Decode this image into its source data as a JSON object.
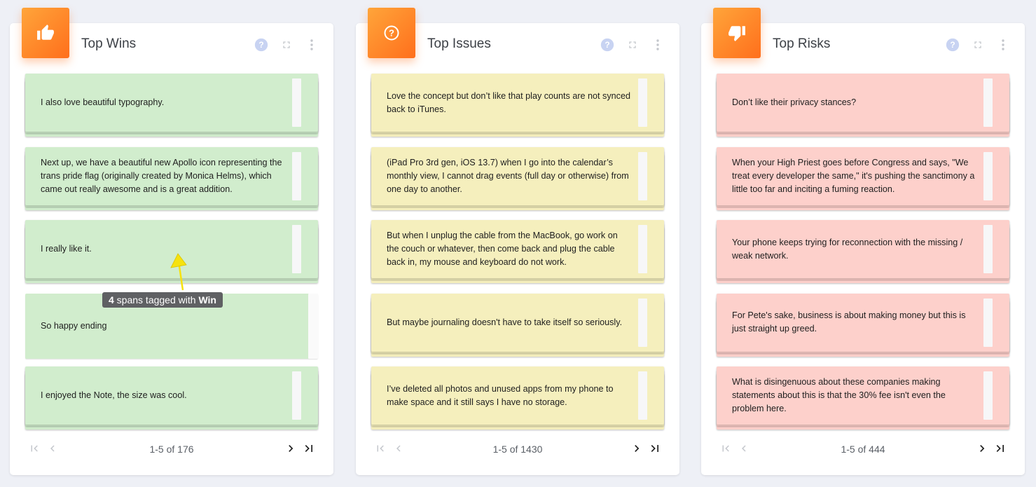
{
  "colors": {
    "accent": "#ff7f24",
    "win": "#d1edcd",
    "issue": "#f5efbd",
    "risk": "#fdd0cb",
    "arrow": "#f6e20e"
  },
  "panels": [
    {
      "title": "Top Wins",
      "icon": "thumbs-up-icon",
      "color": "#d1edcd",
      "cards": [
        "I also love beautiful typography.",
        "Next up, we have a beautiful new Apollo icon representing the trans pride flag (originally created by Monica Helms), which came out really awesome and is a great addition.",
        "I really like it.",
        "So happy ending",
        "I enjoyed the Note, the size was cool."
      ],
      "pagination": "1-5 of 176"
    },
    {
      "title": "Top Issues",
      "icon": "question-circle-icon",
      "color": "#f5efbd",
      "cards": [
        "Love the concept but don’t like that play counts are not synced back to iTunes.",
        "(iPad Pro 3rd gen, iOS 13.7) when I go into the calendar’s monthly view, I cannot drag events (full day or otherwise) from one day to another.",
        "But when I unplug the cable from the MacBook, go work on the couch or whatever, then come back and plug the cable back in, my mouse and keyboard do not work.",
        "But maybe journaling doesn't have to take itself so seriously.",
        "I’ve deleted all photos and unused apps from my phone to make space and it still says I have no storage."
      ],
      "pagination": "1-5 of 1430"
    },
    {
      "title": "Top Risks",
      "icon": "thumbs-down-icon",
      "color": "#fdd0cb",
      "cards": [
        "Don’t like their privacy stances?",
        "When your High Priest goes before Congress and says, \"We treat every developer the same,\" it's pushing the sanctimony a little too far and inciting a fuming reaction.",
        "Your phone keeps trying for reconnection with the missing / weak network.",
        "For Pete's sake, business is about making money but this is just straight up greed.",
        "What is disingenuous about these companies making statements about this is that the 30% fee isn't even the problem here."
      ],
      "pagination": "1-5 of 444"
    }
  ],
  "tooltip": {
    "count": "4",
    "middle": " spans tagged with ",
    "tag": "Win"
  }
}
